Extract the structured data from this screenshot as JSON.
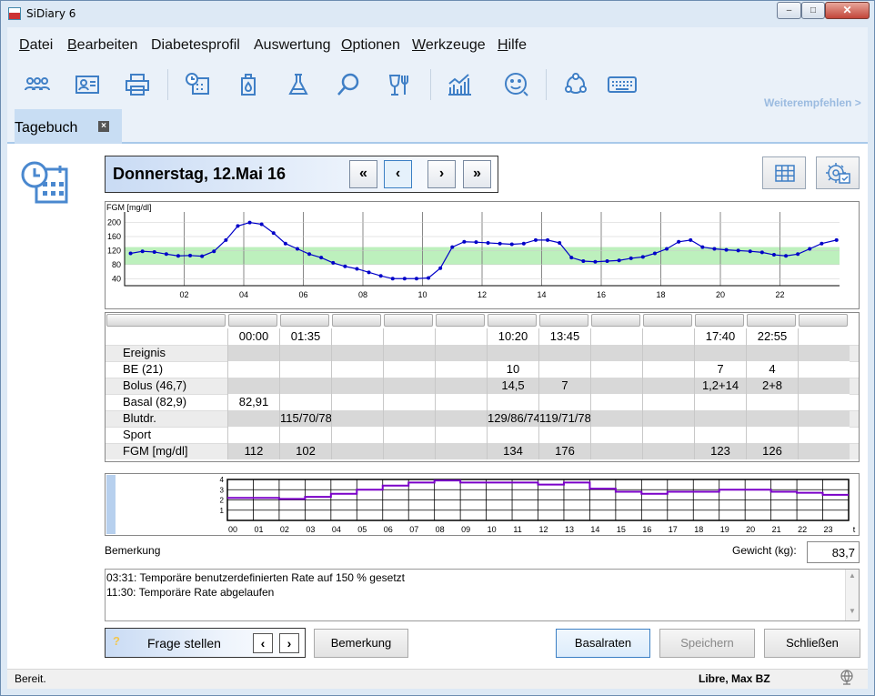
{
  "window": {
    "title": "SiDiary 6",
    "min": "‒",
    "max": "□",
    "close": "✕"
  },
  "menu": [
    {
      "acc": "D",
      "rest": "atei"
    },
    {
      "acc": "B",
      "rest": "earbeiten"
    },
    {
      "acc": "",
      "rest": "Diabetesprofil"
    },
    {
      "acc": "",
      "rest": "Auswertung"
    },
    {
      "acc": "O",
      "rest": "ptionen"
    },
    {
      "acc": "W",
      "rest": "erkzeuge"
    },
    {
      "acc": "H",
      "rest": "ilfe"
    }
  ],
  "toolbar": {
    "icons": [
      "people-icon",
      "contact-card-icon",
      "printer-icon",
      "clock-calendar-icon",
      "glucose-meter-icon",
      "lab-flask-icon",
      "search-icon",
      "food-drink-icon",
      "statistics-chart-icon",
      "smiley-icon",
      "community-icon",
      "keyboard-icon"
    ],
    "recommend": "Weiterempfehlen >"
  },
  "tab": {
    "label": "Tagebuch",
    "close": "×"
  },
  "date": {
    "label": "Donnerstag, 12.Mai 16",
    "first": "«",
    "prev": "‹",
    "next": "›",
    "last": "»"
  },
  "chart_data": {
    "type": "line",
    "ylabel": "FGM [mg/dl]",
    "yticks": [
      200,
      160,
      120,
      80,
      40
    ],
    "ylim": [
      20,
      230
    ],
    "xlim": [
      0,
      24
    ],
    "xticks": [
      "02",
      "04",
      "06",
      "08",
      "10",
      "12",
      "14",
      "16",
      "18",
      "20",
      "22"
    ],
    "target_range": [
      80,
      130
    ],
    "colors": {
      "line": "#0000c8",
      "target": "#bdf0bd",
      "grid": "#888888"
    },
    "x": [
      0.2,
      0.6,
      1.0,
      1.4,
      1.8,
      2.2,
      2.6,
      3.0,
      3.4,
      3.8,
      4.2,
      4.6,
      5.0,
      5.4,
      5.8,
      6.2,
      6.6,
      7.0,
      7.4,
      7.8,
      8.2,
      8.6,
      9.0,
      9.4,
      9.8,
      10.2,
      10.6,
      11.0,
      11.4,
      11.8,
      12.2,
      12.6,
      13.0,
      13.4,
      13.8,
      14.2,
      14.6,
      15.0,
      15.4,
      15.8,
      16.2,
      16.6,
      17.0,
      17.4,
      17.8,
      18.2,
      18.6,
      19.0,
      19.4,
      19.8,
      20.2,
      20.6,
      21.0,
      21.4,
      21.8,
      22.2,
      22.6,
      23.0,
      23.4,
      23.9
    ],
    "y": [
      112,
      118,
      116,
      110,
      105,
      106,
      104,
      118,
      150,
      190,
      200,
      195,
      170,
      140,
      125,
      110,
      100,
      85,
      75,
      68,
      58,
      48,
      40,
      40,
      40,
      42,
      70,
      130,
      145,
      144,
      142,
      140,
      138,
      140,
      150,
      150,
      142,
      100,
      90,
      88,
      90,
      92,
      98,
      102,
      112,
      125,
      145,
      150,
      130,
      125,
      122,
      120,
      118,
      115,
      108,
      105,
      110,
      125,
      140,
      150
    ]
  },
  "table": {
    "times": [
      "",
      "00:00",
      "01:35",
      "",
      "",
      "",
      "10:20",
      "13:45",
      "",
      "",
      "17:40",
      "22:55",
      ""
    ],
    "rows": [
      {
        "label": "Ereignis",
        "values": [
          "",
          "",
          "",
          "",
          "",
          "",
          "",
          "",
          "",
          "",
          "",
          ""
        ]
      },
      {
        "label": "BE (21)",
        "values": [
          "",
          "",
          "",
          "",
          "",
          "10",
          "",
          "",
          "",
          "7",
          "4",
          ""
        ]
      },
      {
        "label": "Bolus (46,7)",
        "values": [
          "",
          "",
          "",
          "",
          "",
          "14,5",
          "7",
          "",
          "",
          "1,2+14",
          "2+8",
          ""
        ]
      },
      {
        "label": "Basal (82,9)",
        "values": [
          "82,91",
          "",
          "",
          "",
          "",
          "",
          "",
          "",
          "",
          "",
          "",
          ""
        ]
      },
      {
        "label": "Blutdr.",
        "values": [
          "",
          "115/70/78",
          "",
          "",
          "",
          "129/86/74",
          "119/71/78",
          "",
          "",
          "",
          "",
          ""
        ]
      },
      {
        "label": "Sport",
        "values": [
          "",
          "",
          "",
          "",
          "",
          "",
          "",
          "",
          "",
          "",
          "",
          ""
        ]
      },
      {
        "label": "FGM [mg/dl]",
        "values": [
          "112",
          "102",
          "",
          "",
          "",
          "134",
          "176",
          "",
          "",
          "123",
          "126",
          ""
        ]
      }
    ]
  },
  "basal": {
    "yticks": [
      "4",
      "3",
      "2",
      "1"
    ],
    "hours": [
      "00",
      "01",
      "02",
      "03",
      "04",
      "05",
      "06",
      "07",
      "08",
      "09",
      "10",
      "11",
      "12",
      "13",
      "14",
      "15",
      "16",
      "17",
      "18",
      "19",
      "20",
      "21",
      "22",
      "23",
      "t"
    ],
    "rates": [
      2.2,
      2.2,
      2.1,
      2.3,
      2.6,
      3.0,
      3.4,
      3.7,
      3.9,
      3.7,
      3.7,
      3.7,
      3.5,
      3.7,
      3.1,
      2.8,
      2.6,
      2.8,
      2.8,
      3.0,
      3.0,
      2.8,
      2.7,
      2.5
    ],
    "color": "#7a00c8"
  },
  "notes": {
    "label": "Bemerkung",
    "lines": [
      "03:31: Temporäre benutzerdefinierten Rate auf 150 % gesetzt",
      "11:30: Temporäre Rate abgelaufen"
    ]
  },
  "weight": {
    "label": "Gewicht (kg):",
    "value": "83,7"
  },
  "buttons": {
    "frage": "Frage stellen",
    "frage_icon": "?",
    "frage_prev": "‹",
    "frage_next": "›",
    "bemerkung": "Bemerkung",
    "basalraten": "Basalraten",
    "speichern": "Speichern",
    "schliessen": "Schließen"
  },
  "status": {
    "text": "Bereit.",
    "user": "Libre, Max BZ"
  }
}
